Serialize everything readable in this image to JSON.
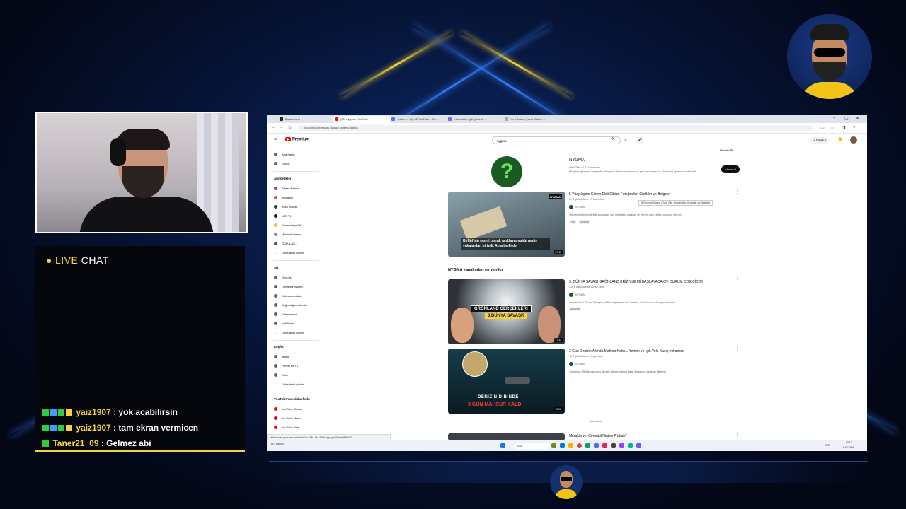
{
  "chat": {
    "title_live": "LIVE",
    "title_chat": "CHAT",
    "messages": [
      {
        "user": "yaiz1907",
        "text": ": yok acabilirsin"
      },
      {
        "user": "yaiz1907",
        "text": ": tam ekran vermicen"
      },
      {
        "user": "Taner21_09",
        "text": ": Gelmez abi"
      }
    ]
  },
  "browser": {
    "tabs": [
      {
        "label": "Başarısız iş"
      },
      {
        "label": "(35) nygma - YouTube"
      },
      {
        "label": "Twitter ... XQ 62 YouTube - Go..."
      },
      {
        "label": "Yönetici ile ilgili görüntü ..."
      },
      {
        "label": "Yeni Sekme | Yeni Sekme ..."
      }
    ],
    "url": "youtube.com/results?search_query=nygma",
    "logo": "Premium",
    "search_value": "nygma",
    "create_label": "+ Oluştur",
    "notif_count": "9+"
  },
  "sidebar": {
    "top": [
      "Ana Sayfa",
      "Shorts"
    ],
    "subs_title": "Abonelikler",
    "subs": [
      "Taylan Reede",
      "Yediterlik",
      "Yoku Bölüm...",
      "LDE TV",
      "Fenerbahçe SK",
      "Mehmet Lemur",
      "ÖZBULAŞ..."
    ],
    "show_more_1": "Daha fazla göster",
    "you_title": "Siz",
    "you": [
      "Geçmiş",
      "Oynatma listeleri",
      "Daha sonra izle",
      "Beğendiğim videolar",
      "Videolarınız",
      "İndirilenler"
    ],
    "show_more_2": "Daha fazla göster",
    "explore_title": "Keşfet",
    "explore": [
      "Müzik",
      "Filmler ve TV",
      "Canlı"
    ],
    "show_more_3": "Daha fazla göster",
    "more_title": "YouTube'dan daha fazla",
    "more": [
      "YouTube Studio",
      "YouTube Music",
      "YouTube Kids"
    ]
  },
  "content": {
    "filters": "Filtreler",
    "channel_name": "NYGMA",
    "channel_meta": "@NYGMA • 1,27 Mn abone",
    "channel_desc": "Hikâyeler, gizemler, belgeseller. Her şeyin bir açıklaması var mı, peki ya olmayanlar... Mistisizm, gizem ve antik tarih...",
    "subscribe": "Abone ol",
    "channel_icon": "?",
    "section": "NYGMA kanalından en yeniler",
    "tooltip": "5 Yüzyıllık Gizem Çözül Gibi: Fotoğraflar, Gizemler ve Belgeler",
    "videos": [
      {
        "title": "5 Yüzyılıgizin Gizem Ekili Gibimi Fotoğraflar, Gizlikler ve Belgeler",
        "meta": "81 B görüntüleme • 3 hafta önce",
        "channel": "NYGMA",
        "desc": "Videom dediçünüz birlikte sayılgaçer, mu, beklediniz yaşanan ne olu her olası verilen sonuç ve bilgi de...",
        "tags": [
          "Yeni",
          "Altyazılar"
        ],
        "thumb_text": "Birliği'nin resmi olarak açıklayamadığı nadir vakalardan biriydi. Ama belki de",
        "duration": "27:43",
        "thumb_badge": "NYGMA"
      },
      {
        "title": "3. DÜNYA SAVAŞI GRÖNLAND KRİZİYLE Mİ BAŞLAYACAK? | DURUM ÇOK CİDDİ!",
        "meta": "719 B görüntüleme • 2 gün önce",
        "channel": "NYGMA",
        "desc": "Grönland'ın 3. Dünya Savaşı'nın fitilini ateşleyecek mi? Amerika, Danimarka ve Avrupa arasında...",
        "tags": [
          "Altyazılar"
        ],
        "thumb_line1": "GRÖNLAND GERÇEKLERİ",
        "thumb_line2": "3.DÜNYA SAVAŞI?",
        "duration": "17:11"
      },
      {
        "title": "3 Gün Denizin Altında Mahsur Kaldı... Yemek ve Işık Yok, Kaçış İmkansız!",
        "meta": "42 B görüntüleme • 3 gün önce",
        "channel": "NYGMA",
        "desc": "Yıllar önce 1983'te yaşanmış, denizin altında mahsur kalan 3 adamın inanılmaz hikâyesi...",
        "tags": [],
        "thumb_line1": "DENİZİN DİBİNDE",
        "thumb_line2": "3 GÜN MAHSUR KALDI",
        "duration": "15:06"
      },
      {
        "title": "Merakla ve: Çernobil Neden Patladı?",
        "meta": "",
        "channel": "",
        "desc": "",
        "tags": []
      }
    ],
    "more_label": "Daha fazla"
  },
  "statusbar": {
    "url": "https://www.youtube.com/watch?v=c4B...&t=1985s&pp=ygUFbnlnbWE%3D"
  },
  "taskbar": {
    "weather": "6°C Parçalı",
    "search": "Ara",
    "time": "18:12",
    "date": "2.02.2026",
    "lang": "TUR"
  },
  "colors": {
    "accent_yellow": "#f5d23a",
    "yt_red": "#ff0000",
    "bg_blue": "#071437"
  }
}
